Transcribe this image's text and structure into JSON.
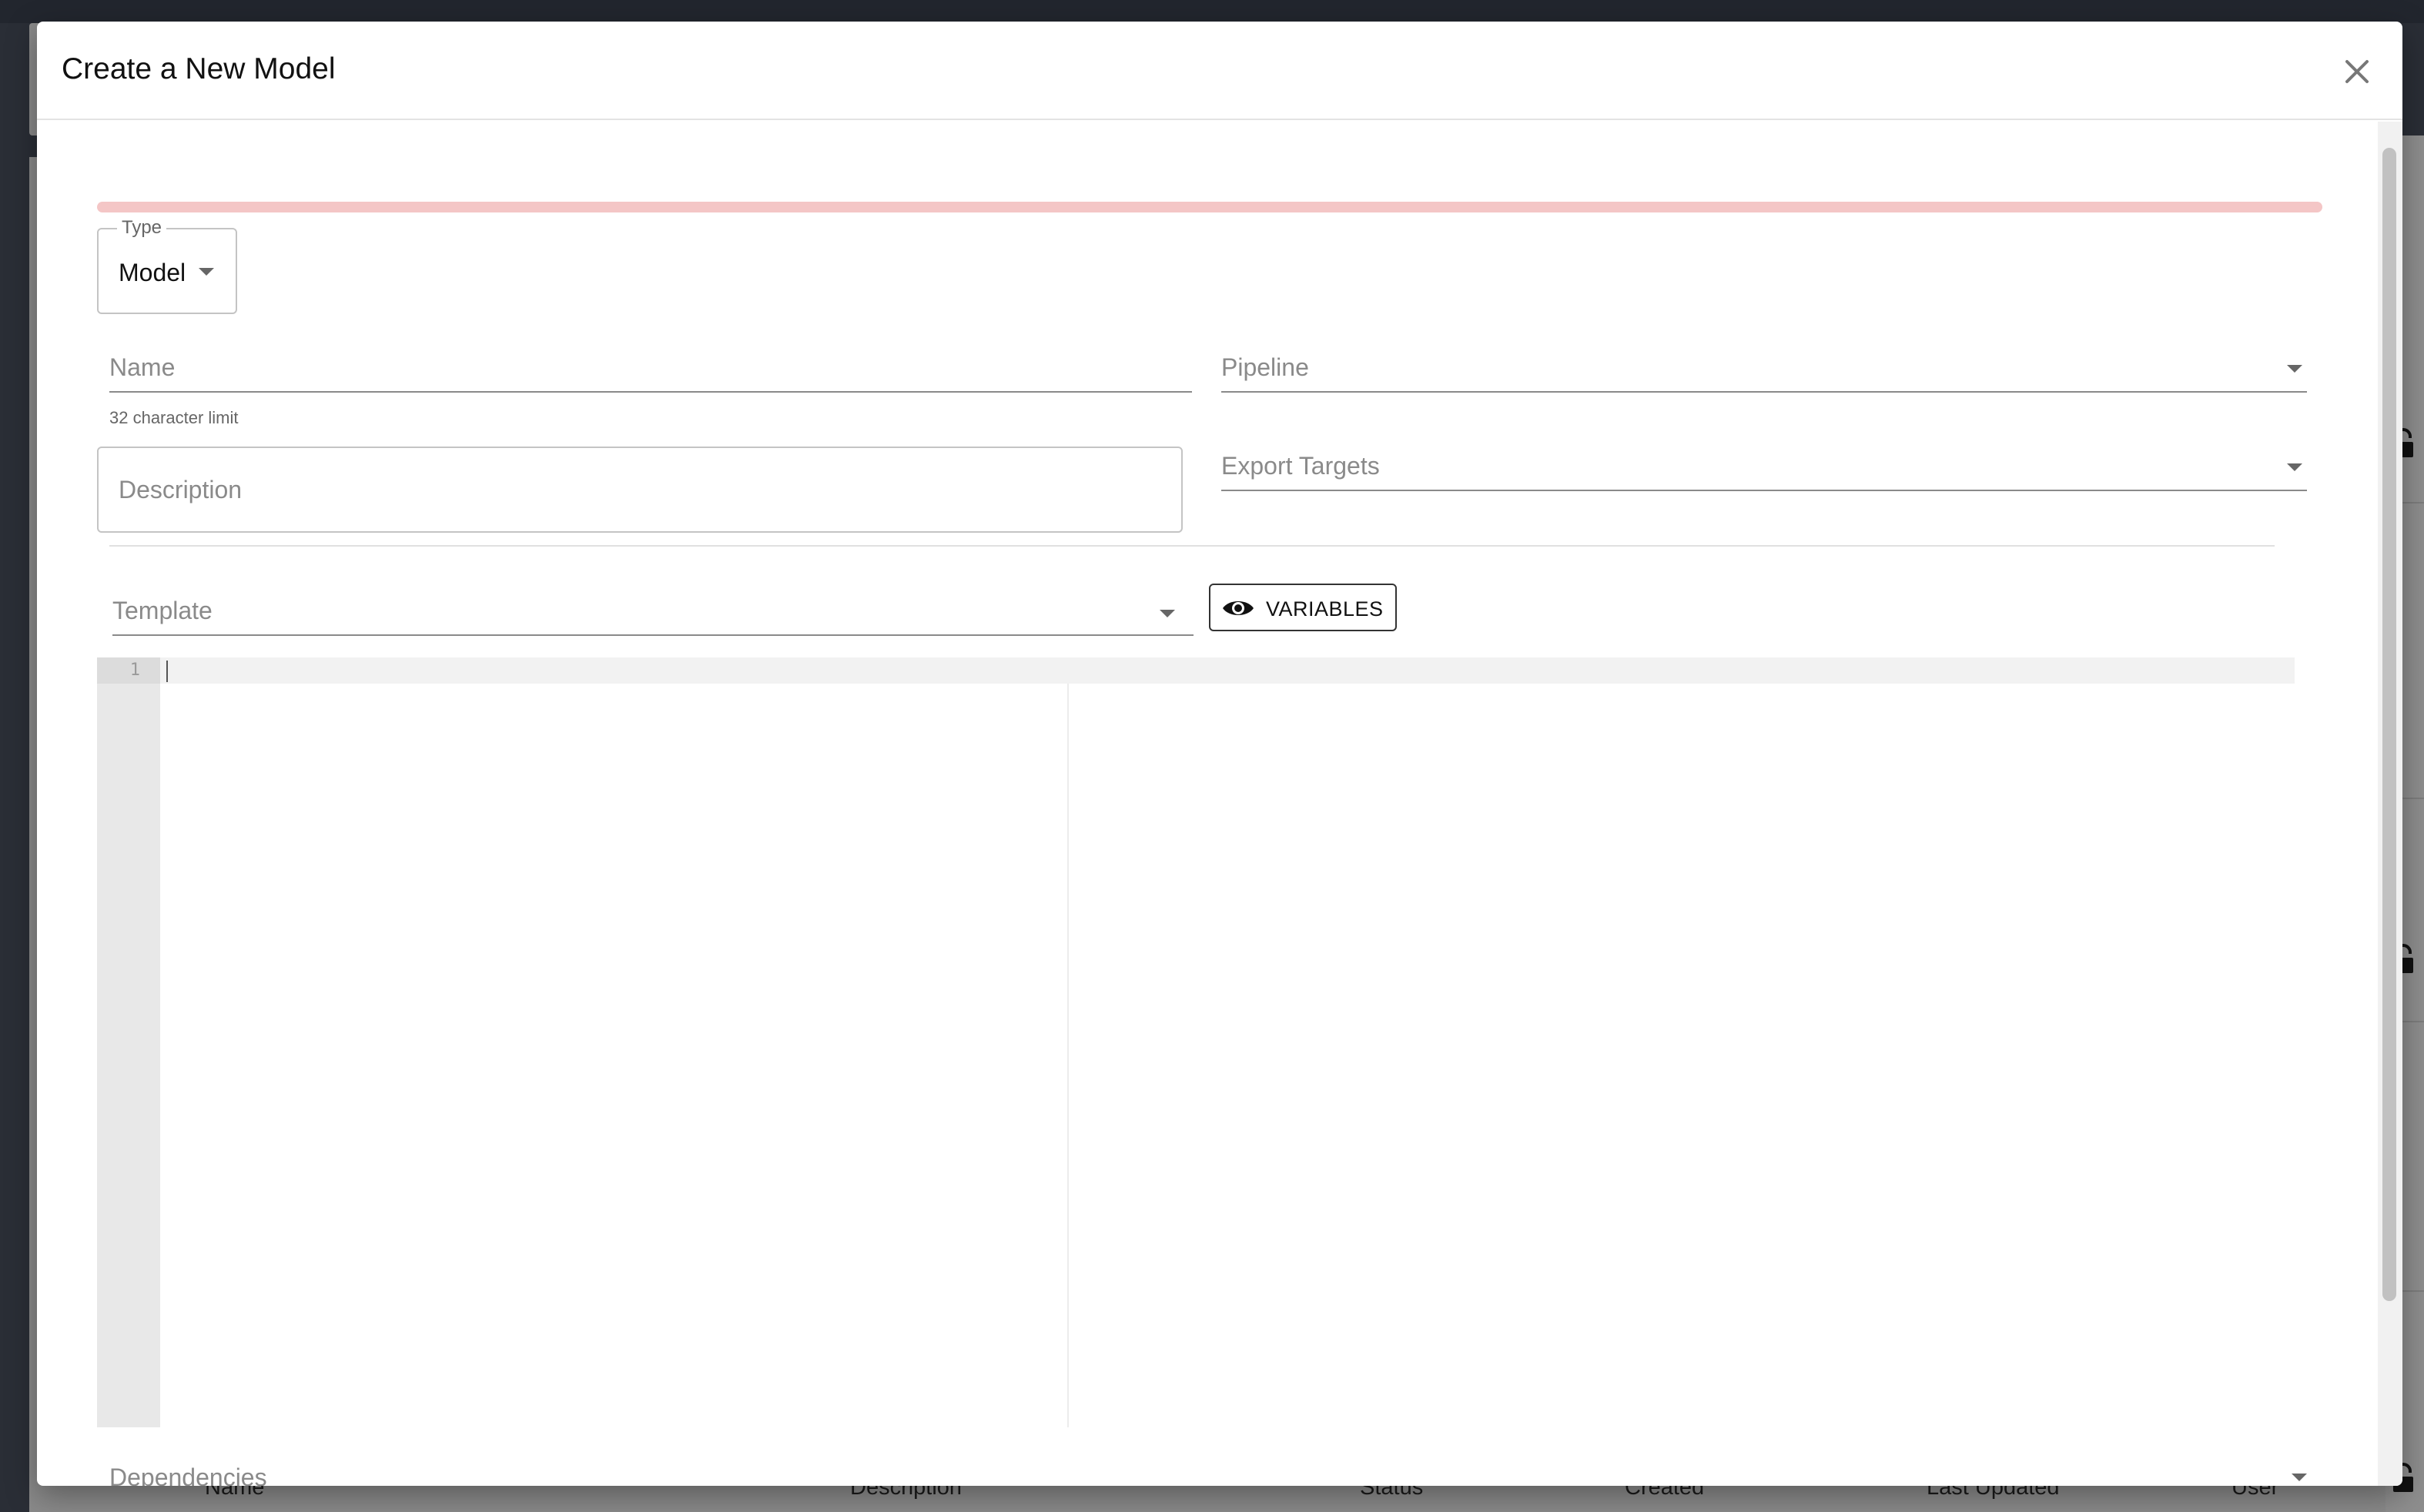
{
  "modal": {
    "title": "Create a New Model",
    "progress_color": "#f4c6c6"
  },
  "type_select": {
    "legend": "Type",
    "value": "Model"
  },
  "fields": {
    "name_label": "Name",
    "name_helper": "32 character limit",
    "pipeline_label": "Pipeline",
    "description_label": "Description",
    "export_targets_label": "Export Targets",
    "template_label": "Template",
    "dependencies_label": "Dependencies"
  },
  "variables_button": {
    "label": "VARIABLES",
    "icon": "eye-icon"
  },
  "editor": {
    "line_numbers": [
      "1"
    ]
  },
  "background_table": {
    "headers": [
      "Name",
      "Description",
      "Status",
      "Created",
      "Last Updated",
      "User"
    ]
  }
}
